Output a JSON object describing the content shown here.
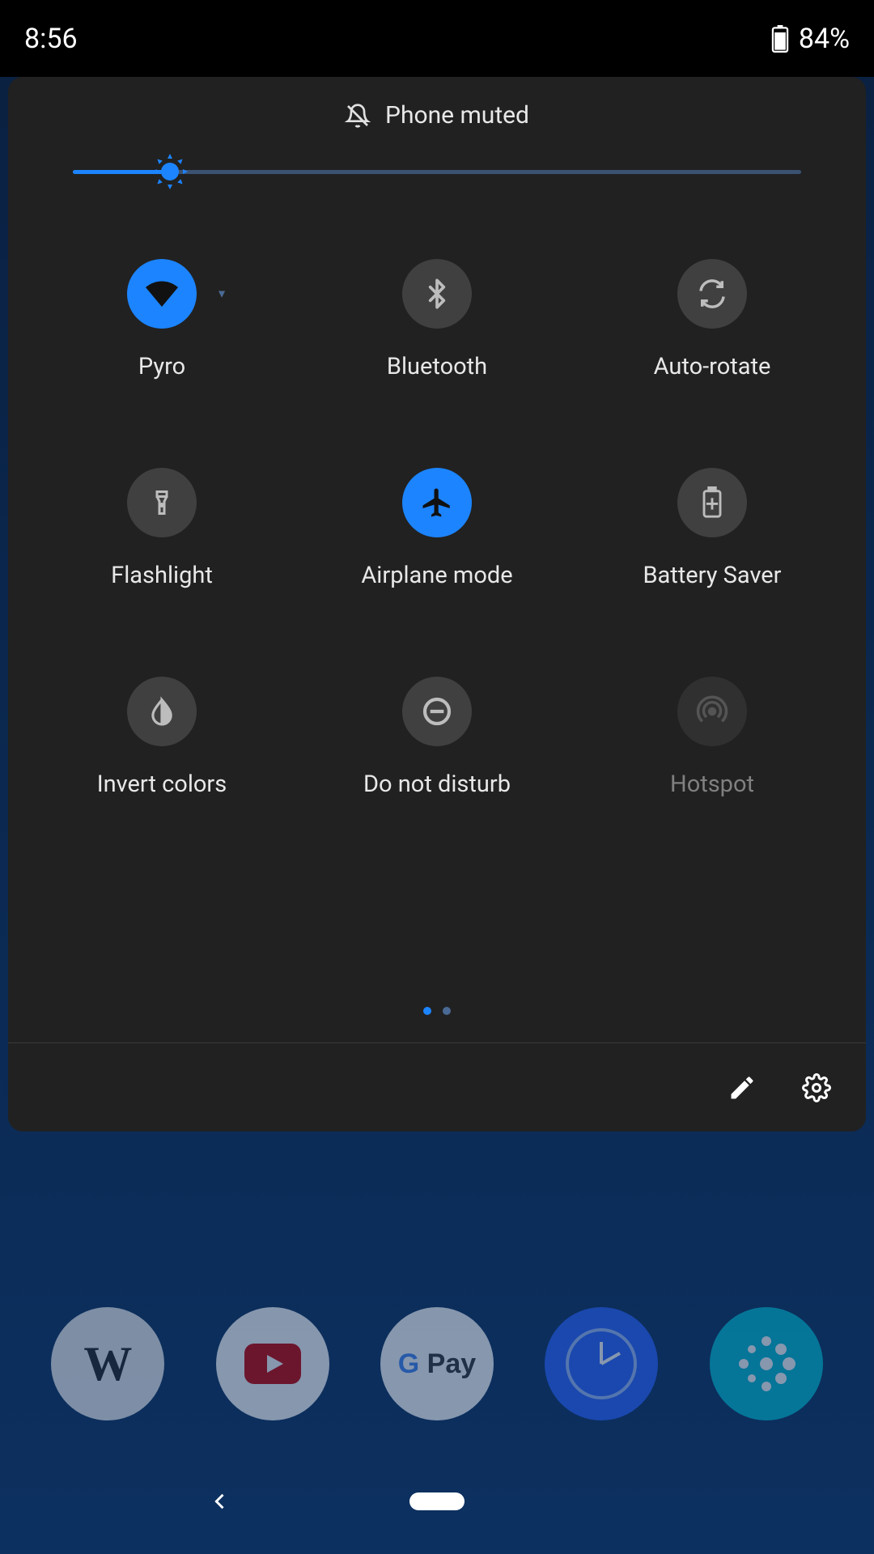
{
  "status": {
    "time": "8:56",
    "battery_pct": "84%"
  },
  "qs": {
    "header_text": "Phone muted",
    "brightness_pct": 18,
    "tiles": [
      {
        "label": "Pyro",
        "active": true,
        "icon": "wifi",
        "caret": true
      },
      {
        "label": "Bluetooth",
        "active": false,
        "icon": "bluetooth"
      },
      {
        "label": "Auto-rotate",
        "active": false,
        "icon": "autorotate"
      },
      {
        "label": "Flashlight",
        "active": false,
        "icon": "flashlight"
      },
      {
        "label": "Airplane mode",
        "active": true,
        "icon": "airplane"
      },
      {
        "label": "Battery Saver",
        "active": false,
        "icon": "batterysaver"
      },
      {
        "label": "Invert colors",
        "active": false,
        "icon": "invert"
      },
      {
        "label": "Do not disturb",
        "active": false,
        "icon": "dnd"
      },
      {
        "label": "Hotspot",
        "active": false,
        "icon": "hotspot",
        "disabled": true
      }
    ],
    "pager_count": 2,
    "pager_active": 0
  },
  "dock": [
    "W",
    "YT",
    "GP",
    "CK",
    "FB"
  ]
}
